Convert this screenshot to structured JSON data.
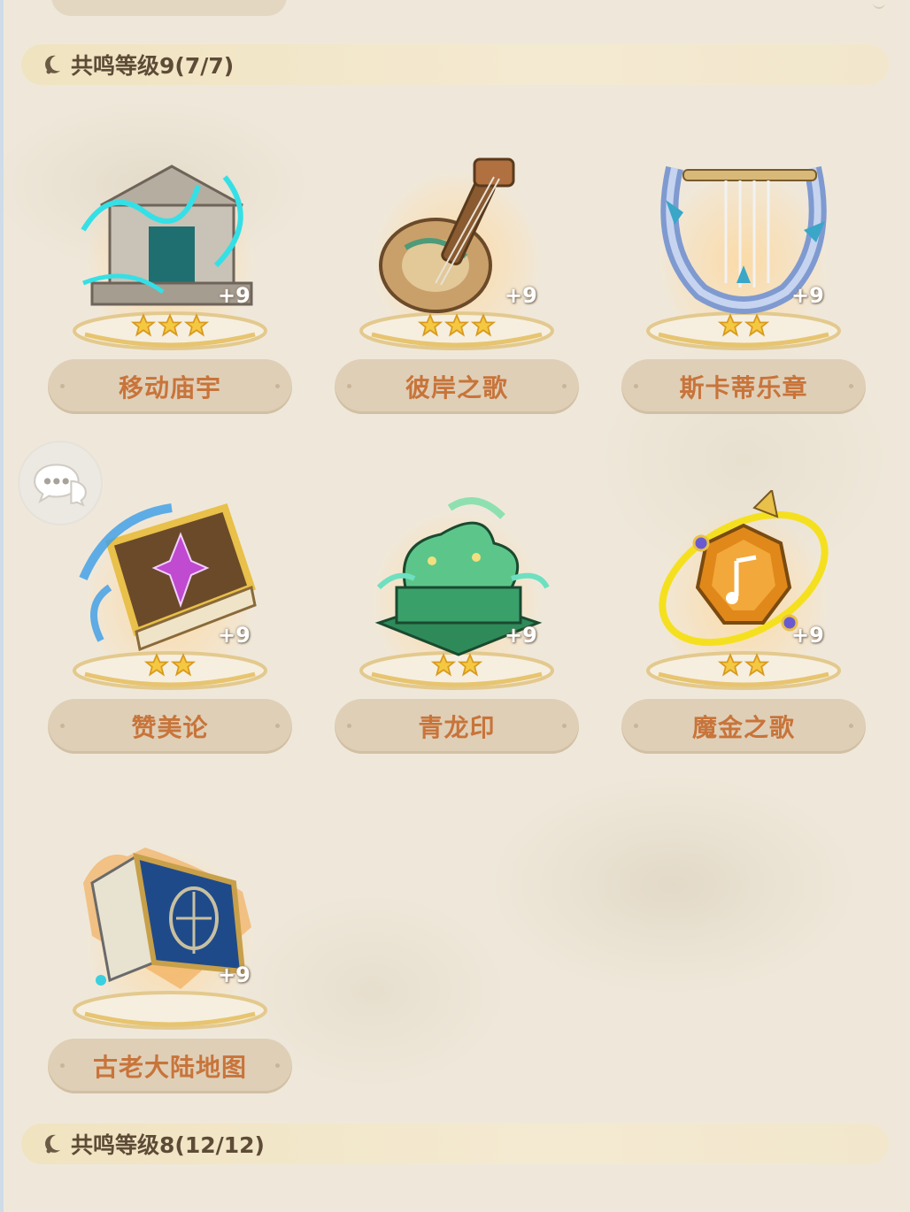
{
  "sections": [
    {
      "title": "共鸣等级9(7/7)"
    },
    {
      "title": "共鸣等级8(12/12)"
    }
  ],
  "items": [
    {
      "name": "移动庙宇",
      "level": "+9",
      "stars": 3,
      "icon": "temple-icon"
    },
    {
      "name": "彼岸之歌",
      "level": "+9",
      "stars": 3,
      "icon": "lute-icon"
    },
    {
      "name": "斯卡蒂乐章",
      "level": "+9",
      "stars": 2,
      "icon": "lyre-icon"
    },
    {
      "name": "赞美论",
      "level": "+9",
      "stars": 2,
      "icon": "tome-icon"
    },
    {
      "name": "青龙印",
      "level": "+9",
      "stars": 2,
      "icon": "dragon-seal-icon"
    },
    {
      "name": "魔金之歌",
      "level": "+9",
      "stars": 2,
      "icon": "amber-orb-icon"
    },
    {
      "name": "古老大陆地图",
      "level": "+9",
      "stars": 0,
      "icon": "map-book-icon"
    }
  ],
  "colors": {
    "name_text": "#c8743a",
    "header_text": "#5d4b37",
    "star": "#f5c842"
  }
}
